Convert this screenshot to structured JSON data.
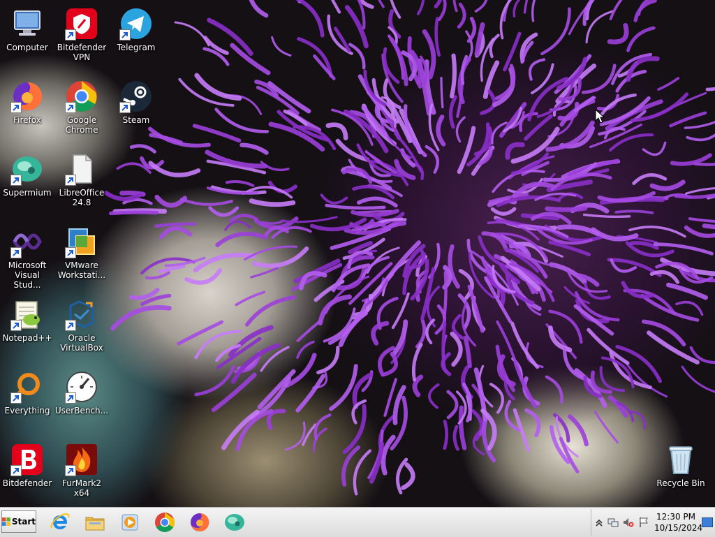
{
  "desktop": {
    "icons": [
      {
        "label": "Computer",
        "icon": "computer-icon",
        "shortcut": false
      },
      {
        "label": "Bitdefender VPN",
        "icon": "bitdefender-vpn-icon",
        "shortcut": true
      },
      {
        "label": "Telegram",
        "icon": "telegram-icon",
        "shortcut": true
      },
      {
        "label": "Firefox",
        "icon": "firefox-icon",
        "shortcut": true
      },
      {
        "label": "Google Chrome",
        "icon": "chrome-icon",
        "shortcut": true
      },
      {
        "label": "Steam",
        "icon": "steam-icon",
        "shortcut": true
      },
      {
        "label": "Supermium",
        "icon": "supermium-icon",
        "shortcut": true
      },
      {
        "label": "LibreOffice 24.8",
        "icon": "libreoffice-icon",
        "shortcut": true
      },
      {
        "label": "Microsoft Visual Stud...",
        "icon": "visual-studio-icon",
        "shortcut": true
      },
      {
        "label": "VMware Workstati...",
        "icon": "vmware-icon",
        "shortcut": true
      },
      {
        "label": "Notepad++",
        "icon": "notepad-plus-plus-icon",
        "shortcut": true
      },
      {
        "label": "Oracle VirtualBox",
        "icon": "virtualbox-icon",
        "shortcut": true
      },
      {
        "label": "Everything",
        "icon": "everything-search-icon",
        "shortcut": true
      },
      {
        "label": "UserBench...",
        "icon": "userbenchmark-icon",
        "shortcut": true
      },
      {
        "label": "Bitdefender",
        "icon": "bitdefender-icon",
        "shortcut": true
      },
      {
        "label": "FurMark2 x64",
        "icon": "furmark-icon",
        "shortcut": true
      },
      {
        "label": "Recycle Bin",
        "icon": "recycle-bin-icon",
        "shortcut": false
      }
    ]
  },
  "taskbar": {
    "start_label": "Start",
    "pinned": [
      {
        "name": "internet-explorer-icon"
      },
      {
        "name": "file-explorer-icon"
      },
      {
        "name": "media-player-icon"
      },
      {
        "name": "chrome-icon"
      },
      {
        "name": "firefox-icon"
      },
      {
        "name": "supermium-icon"
      }
    ],
    "tray": {
      "time": "12:30 PM",
      "date": "10/15/2024"
    }
  },
  "colors": {
    "bitdefender_red": "#e3001b",
    "telegram_blue": "#2aa3df",
    "steam_dark": "#1b2838",
    "chrome_red": "#db4437",
    "chrome_yellow": "#f4c20d",
    "chrome_green": "#0f9d58",
    "chrome_blue": "#4285f4",
    "firefox_orange": "#ff7139",
    "firefox_purple": "#6b2fc4",
    "supermium_teal": "#35b59a"
  }
}
